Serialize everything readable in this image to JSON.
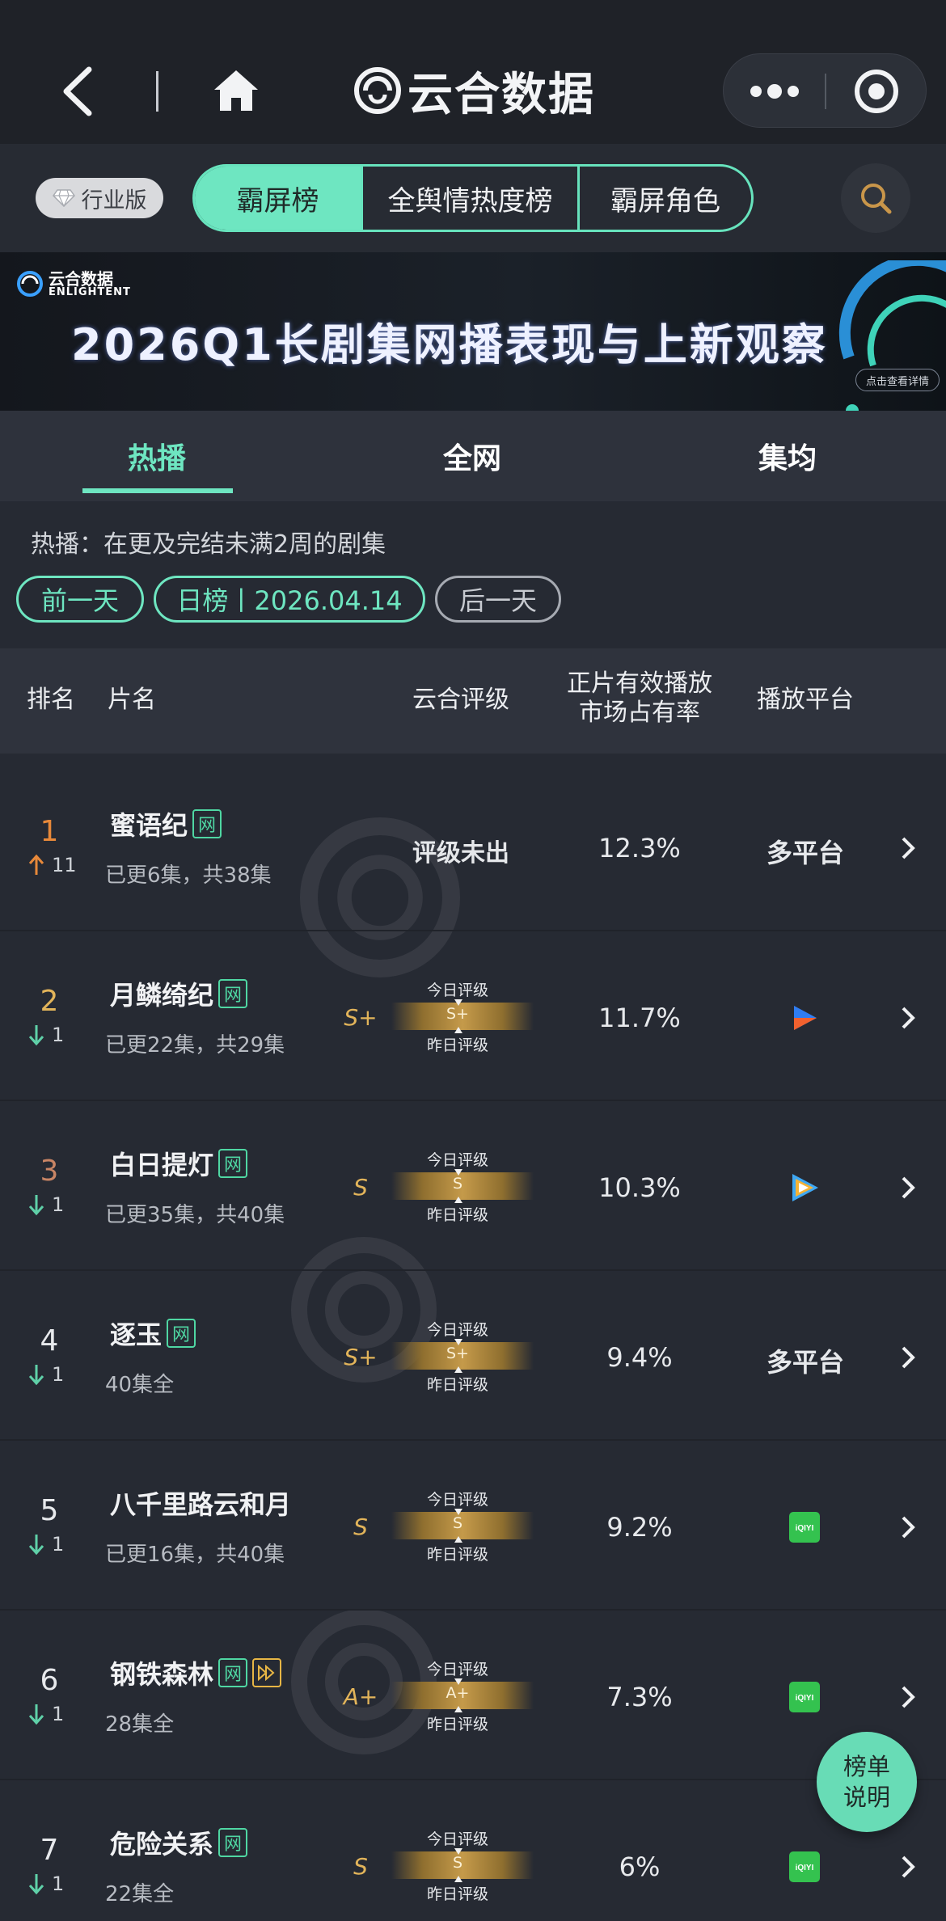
{
  "header": {
    "app_title": "云合数据",
    "icons": [
      "back-icon",
      "home-icon",
      "app-logo-icon",
      "more-icon",
      "target-icon"
    ]
  },
  "categories": {
    "edition_badge": "行业版",
    "tabs": [
      {
        "label": "霸屏榜",
        "active": true
      },
      {
        "label": "全舆情热度榜",
        "active": false
      },
      {
        "label": "霸屏角色",
        "active": false
      }
    ]
  },
  "banner": {
    "logo_cn": "云合数据",
    "logo_en": "ENLIGHTENT",
    "title": "2026Q1长剧集网播表现与上新观察",
    "cta": "点击查看详情"
  },
  "subtabs": [
    {
      "label": "热播",
      "active": true
    },
    {
      "label": "全网",
      "active": false
    },
    {
      "label": "集均",
      "active": false
    }
  ],
  "note": "热播：在更及完结未满2周的剧集",
  "date_nav": {
    "prev": "前一天",
    "current": "日榜丨2026.04.14",
    "next": "后一天"
  },
  "table": {
    "headers": {
      "rank": "排名",
      "title": "片名",
      "rating": "云合评级",
      "share_line1": "正片有效播放",
      "share_line2": "市场占有率",
      "platform": "播放平台"
    },
    "rating_today": "今日评级",
    "rating_yesterday": "昨日评级",
    "rows": [
      {
        "rank": "1",
        "trend": "up",
        "change": "11",
        "title": "蜜语纪",
        "tag": "网",
        "episodes": "已更6集，共38集",
        "grade": "",
        "rating_text": "评级未出",
        "share": "12.3%",
        "platform": "多平台",
        "platform_icon": ""
      },
      {
        "rank": "2",
        "trend": "down",
        "change": "1",
        "title": "月鳞绮纪",
        "tag": "网",
        "episodes": "已更22集，共29集",
        "grade": "S+",
        "rating_text": "",
        "share": "11.7%",
        "platform": "",
        "platform_icon": "youku-icon"
      },
      {
        "rank": "3",
        "trend": "down",
        "change": "1",
        "title": "白日提灯",
        "tag": "网",
        "episodes": "已更35集，共40集",
        "grade": "S",
        "rating_text": "",
        "share": "10.3%",
        "platform": "",
        "platform_icon": "tencent-video-icon"
      },
      {
        "rank": "4",
        "trend": "down",
        "change": "1",
        "title": "逐玉",
        "tag": "网",
        "episodes": "40集全",
        "grade": "S+",
        "rating_text": "",
        "share": "9.4%",
        "platform": "多平台",
        "platform_icon": ""
      },
      {
        "rank": "5",
        "trend": "down",
        "change": "1",
        "title": "八千里路云和月",
        "tag": "",
        "episodes": "已更16集，共40集",
        "grade": "S",
        "rating_text": "",
        "share": "9.2%",
        "platform": "",
        "platform_icon": "iqiyi-icon",
        "platform_icon_text": "iQIYI"
      },
      {
        "rank": "6",
        "trend": "down",
        "change": "1",
        "title": "钢铁森林",
        "tag": "网",
        "extra_tag": "play-tag-icon",
        "episodes": "28集全",
        "grade": "A+",
        "rating_text": "",
        "share": "7.3%",
        "platform": "",
        "platform_icon": "iqiyi-icon",
        "platform_icon_text": "iQIYI"
      },
      {
        "rank": "7",
        "trend": "down",
        "change": "1",
        "title": "危险关系",
        "tag": "网",
        "episodes": "22集全",
        "grade": "S",
        "rating_text": "",
        "share": "6%",
        "platform": "",
        "platform_icon": "iqiyi-icon",
        "platform_icon_text": "iQIYI"
      }
    ]
  },
  "float_button": {
    "line1": "榜单",
    "line2": "说明"
  },
  "colors": {
    "accent": "#6ee6c1",
    "background": "#262a33",
    "grade": "#e2b45a",
    "trend_up": "#e8893a",
    "trend_down": "#5fd0a8"
  }
}
